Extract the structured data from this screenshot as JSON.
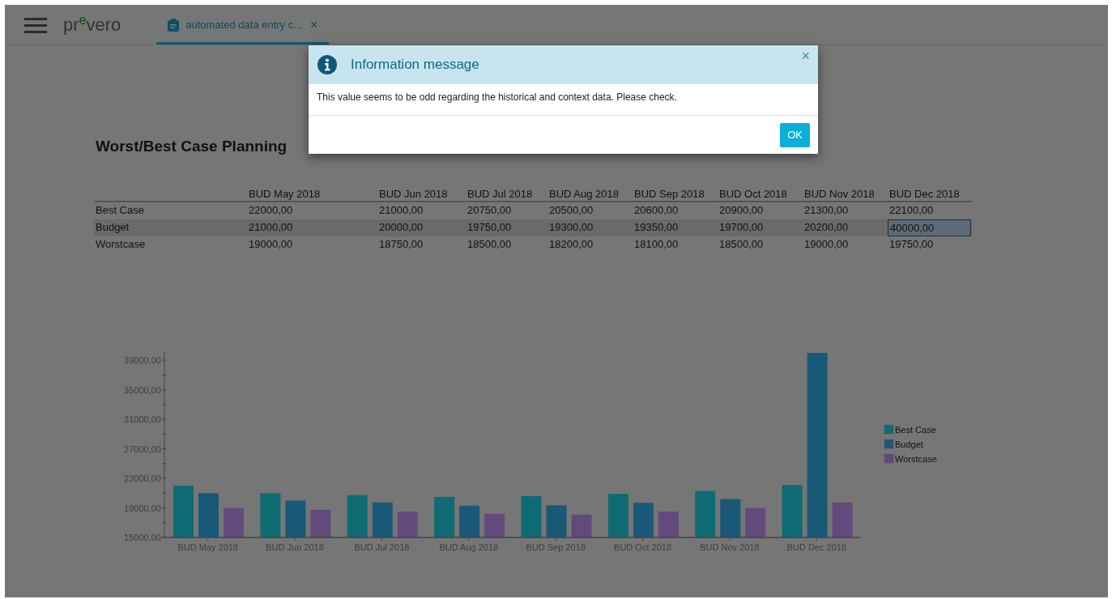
{
  "header": {
    "logo": "pr$^{e}$vero"
  },
  "tabs": [
    {
      "label": "automated data entry c...",
      "selected": true,
      "close": "×"
    }
  ],
  "page": {
    "title": "Worst/Best Case Planning"
  },
  "table": {
    "columns": [
      "",
      "BUD May 2018",
      "BUD Jun 2018",
      "BUD Jul 2018",
      "BUD Aug 2018",
      "BUD Sep 2018",
      "BUD Oct 2018",
      "BUD Nov 2018",
      "BUD Dec 2018"
    ],
    "rows": [
      {
        "selected": false,
        "cells": [
          {
            "value": "Best Case",
            "selected": false
          },
          {
            "value": "22000,00",
            "selected": false
          },
          {
            "value": "21000,00",
            "selected": false
          },
          {
            "value": "20750,00",
            "selected": false
          },
          {
            "value": "20500,00",
            "selected": false
          },
          {
            "value": "20600,00",
            "selected": false
          },
          {
            "value": "20900,00",
            "selected": false
          },
          {
            "value": "21300,00",
            "selected": false
          },
          {
            "value": "22100,00",
            "selected": false
          }
        ]
      },
      {
        "selected": true,
        "cells": [
          {
            "value": "Budget",
            "selected": false
          },
          {
            "value": "21000,00",
            "selected": false
          },
          {
            "value": "20000,00",
            "selected": false
          },
          {
            "value": "19750,00",
            "selected": false
          },
          {
            "value": "19300,00",
            "selected": false
          },
          {
            "value": "19350,00",
            "selected": false
          },
          {
            "value": "19700,00",
            "selected": false
          },
          {
            "value": "20200,00",
            "selected": false
          },
          {
            "value": "40000,00",
            "selected": true
          }
        ]
      },
      {
        "selected": false,
        "cells": [
          {
            "value": "Worstcase",
            "selected": false
          },
          {
            "value": "19000,00",
            "selected": false
          },
          {
            "value": "18750,00",
            "selected": false
          },
          {
            "value": "18500,00",
            "selected": false
          },
          {
            "value": "18200,00",
            "selected": false
          },
          {
            "value": "18100,00",
            "selected": false
          },
          {
            "value": "18500,00",
            "selected": false
          },
          {
            "value": "19000,00",
            "selected": false
          },
          {
            "value": "19750,00",
            "selected": false
          }
        ]
      }
    ]
  },
  "chart": {
    "chart_data": {
      "type": "bar",
      "categories": [
        "BUD May 2018",
        "BUD Jun 2018",
        "BUD Jul 2018",
        "BUD Aug 2018",
        "BUD Sep 2018",
        "BUD Oct 2018",
        "BUD Nov 2018",
        "BUD Dec 2018"
      ],
      "series": [
        {
          "name": "Best Case",
          "color": "#0e6b73",
          "values": [
            22000,
            21000,
            20750,
            20500,
            20600,
            20900,
            21300,
            22100
          ]
        },
        {
          "name": "Budget",
          "color": "#1a5878",
          "values": [
            21000,
            20000,
            19750,
            19300,
            19350,
            19700,
            20200,
            40000
          ]
        },
        {
          "name": "Worstcase",
          "color": "#634a7c",
          "values": [
            19000,
            18750,
            18500,
            18200,
            18100,
            18500,
            19000,
            19750
          ]
        }
      ],
      "legend": true,
      "ylim": [
        15000,
        40000
      ],
      "yticks": [
        {
          "value": 15000,
          "label": "15000,00"
        },
        {
          "value": 19000,
          "label": "19000,00"
        },
        {
          "value": 23000,
          "label": "23000,00"
        },
        {
          "value": 27000,
          "label": "27000,00"
        },
        {
          "value": 31000,
          "label": "31000,00"
        },
        {
          "value": 35000,
          "label": "35000,00"
        },
        {
          "value": 39000,
          "label": "39000,00"
        }
      ]
    }
  },
  "dialog": {
    "title": "Information message",
    "close": "×",
    "message": "This value seems to be odd regarding the historical and context data. Please check.",
    "buttons": [
      "OK"
    ]
  }
}
